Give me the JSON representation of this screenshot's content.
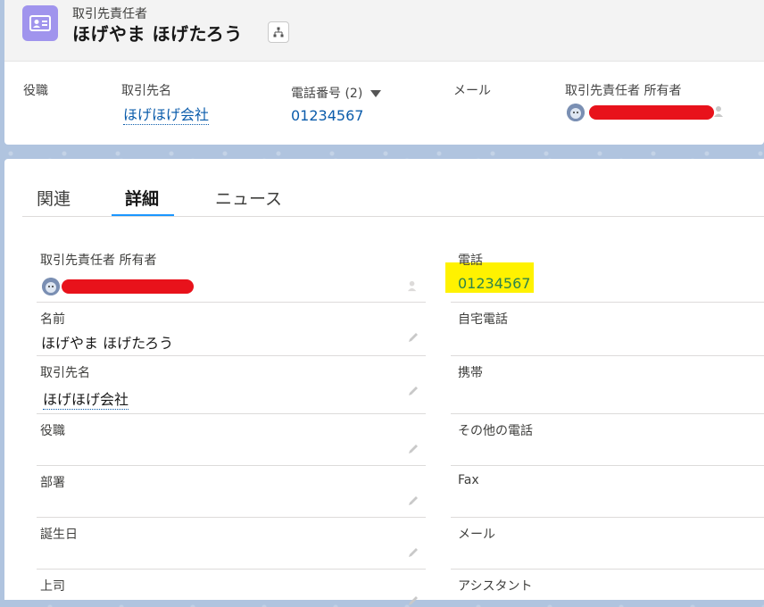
{
  "header": {
    "object_label": "取引先責任者",
    "record_name": "ほげやま ほげたろう",
    "highlights": {
      "title_label": "役職",
      "account_label": "取引先名",
      "account_value": "ほげほげ会社",
      "phone_label": "電話番号 (2)",
      "phone_value": "01234567",
      "email_label": "メール",
      "owner_label": "取引先責任者 所有者"
    }
  },
  "tabs": [
    {
      "label": "関連"
    },
    {
      "label": "詳細"
    },
    {
      "label": "ニュース"
    }
  ],
  "details": {
    "left": [
      {
        "label": "取引先責任者 所有者",
        "value": ""
      },
      {
        "label": "名前",
        "value": "ほげやま ほげたろう"
      },
      {
        "label": "取引先名",
        "value": "ほげほげ会社"
      },
      {
        "label": "役職",
        "value": ""
      },
      {
        "label": "部署",
        "value": ""
      },
      {
        "label": "誕生日",
        "value": ""
      },
      {
        "label": "上司",
        "value": ""
      }
    ],
    "right": [
      {
        "label": "電話",
        "value": "01234567"
      },
      {
        "label": "自宅電話",
        "value": ""
      },
      {
        "label": "携帯",
        "value": ""
      },
      {
        "label": "その他の電話",
        "value": ""
      },
      {
        "label": "Fax",
        "value": ""
      },
      {
        "label": "メール",
        "value": ""
      },
      {
        "label": "アシスタント",
        "value": ""
      }
    ]
  },
  "colors": {
    "accent": "#1b96ff",
    "link": "#0b5cab",
    "contact_icon": "#a094ed",
    "highlight": "#fff200",
    "phone_green": "#2e844a"
  }
}
